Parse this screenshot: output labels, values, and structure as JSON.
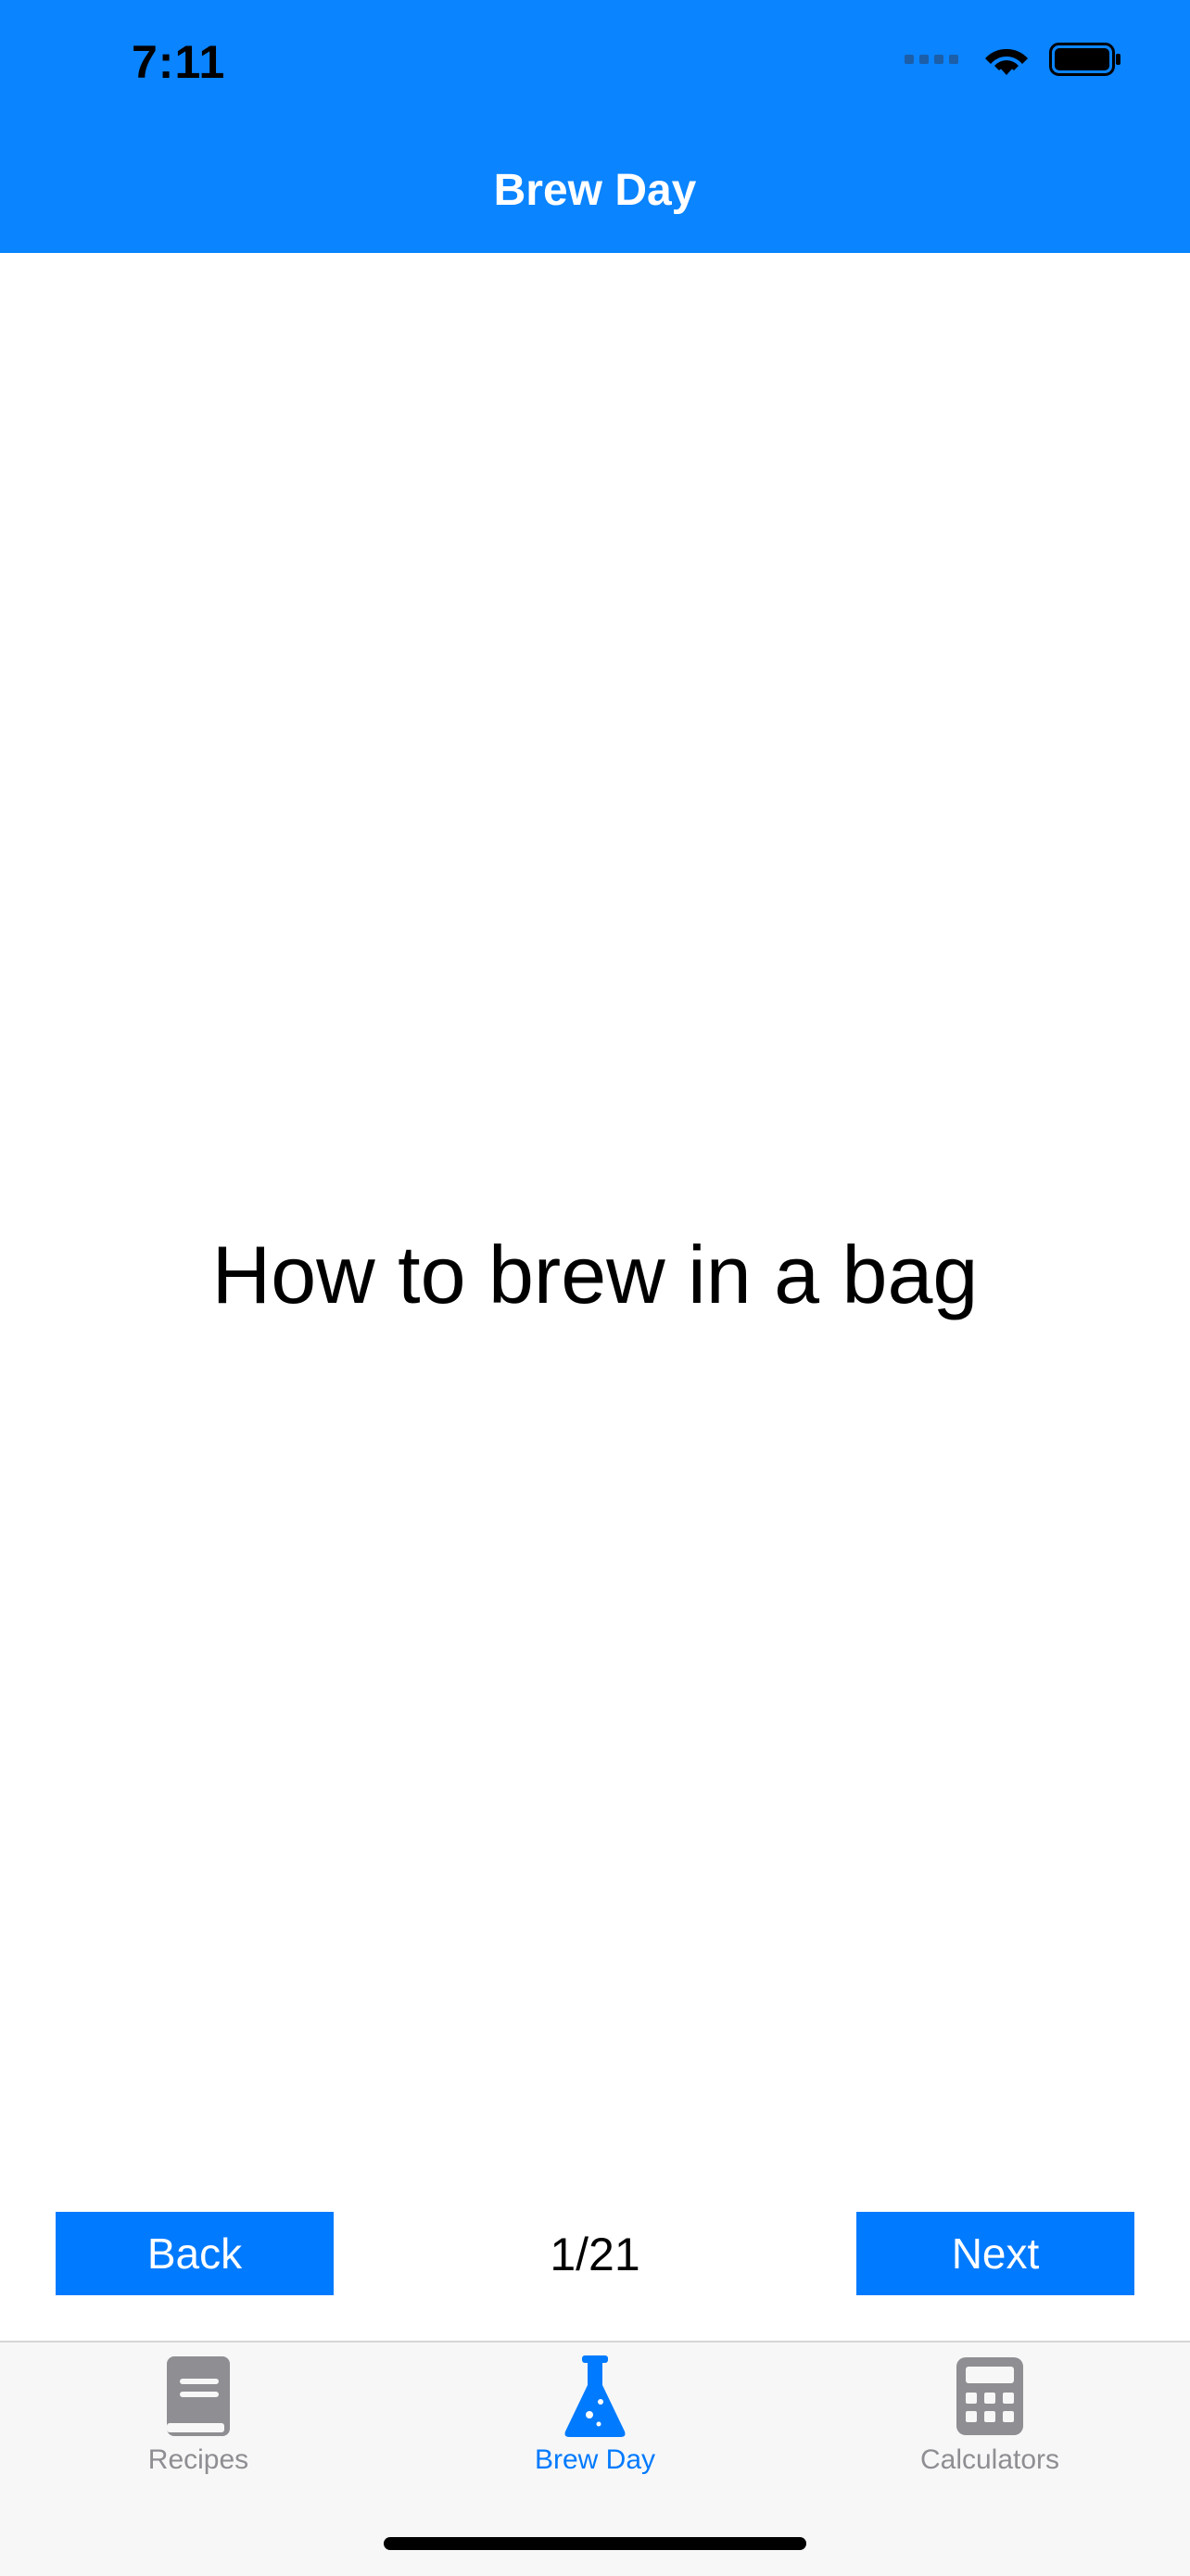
{
  "status_bar": {
    "time": "7:11"
  },
  "nav": {
    "title": "Brew Day"
  },
  "content": {
    "title": "How to brew in a bag"
  },
  "controls": {
    "back_label": "Back",
    "next_label": "Next",
    "page_indicator": "1/21"
  },
  "tabs": [
    {
      "label": "Recipes",
      "icon": "book-icon",
      "active": false
    },
    {
      "label": "Brew Day",
      "icon": "flask-icon",
      "active": true
    },
    {
      "label": "Calculators",
      "icon": "calculator-icon",
      "active": false
    }
  ],
  "colors": {
    "header": "#0a84ff",
    "accent": "#007aff",
    "inactive": "#8e8e93"
  }
}
